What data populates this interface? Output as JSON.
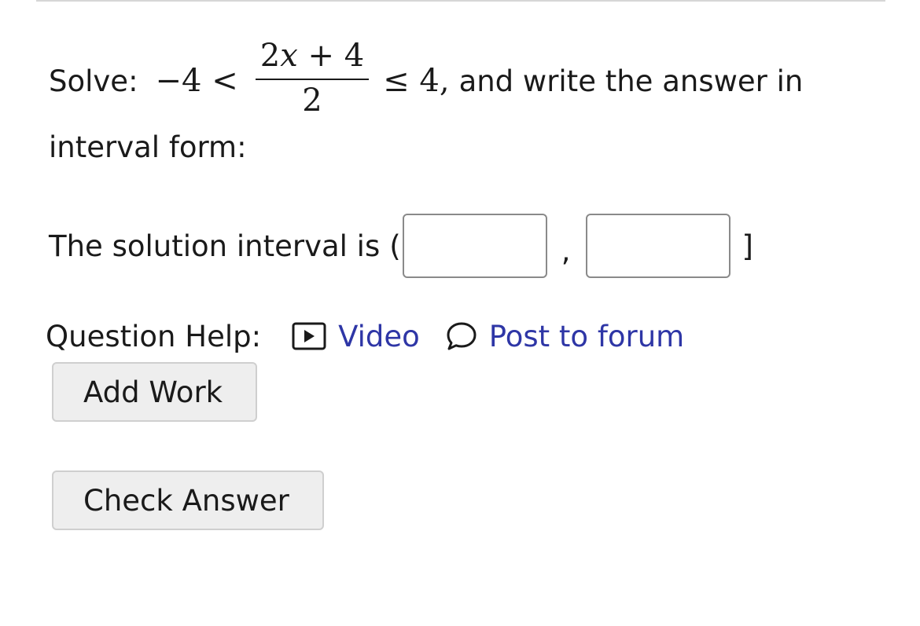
{
  "question": {
    "prefix": "Solve:",
    "lhs": "−4 <",
    "frac_num_coef": "2",
    "frac_num_var": "x",
    "frac_num_rest": " + 4",
    "frac_den": "2",
    "rhs": "≤ 4,",
    "suffix": "and write the answer in",
    "line2": "interval form:"
  },
  "solution": {
    "label": "The solution interval is",
    "open_bracket": "(",
    "separator": ",",
    "close_bracket": "]",
    "lower_value": "",
    "upper_value": ""
  },
  "help": {
    "label": "Question Help:",
    "video_label": "Video",
    "forum_label": "Post to forum",
    "video_icon": "video-play-icon",
    "forum_icon": "speech-bubble-icon",
    "link_color": "#2e36a6"
  },
  "buttons": {
    "add_work": "Add Work",
    "check_answer": "Check Answer"
  }
}
